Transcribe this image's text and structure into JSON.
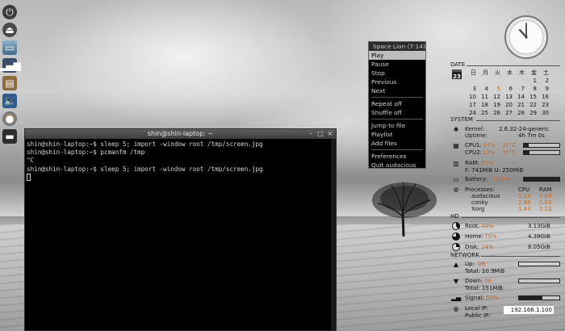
{
  "launcher": {
    "items": [
      {
        "icon": "power-icon"
      },
      {
        "icon": "eject-icon"
      },
      {
        "icon": "drive-icon"
      },
      {
        "icon": "network-signal-icon"
      },
      {
        "icon": "clipboard-icon"
      },
      {
        "icon": "volume-icon"
      },
      {
        "icon": "firefox-icon"
      },
      {
        "icon": "monitor-icon"
      }
    ]
  },
  "terminal": {
    "title": "shin@shin-laptop: ~",
    "lines": [
      "shin@shin-laptop:~$ sleep 5; import -window root /tmp/screen.jpg",
      "shin@shin-laptop:~$ pcmanfm /tmp",
      "^C",
      "shin@shin-laptop:~$ sleep 5; import -window root /tmp/screen.jpg"
    ]
  },
  "menu": {
    "title": "Space Lion (7:14)",
    "groups": [
      [
        "Play",
        "Pause",
        "Stop",
        "Previous",
        "Next"
      ],
      [
        "Repeat off",
        "Shuffle off"
      ],
      [
        "Jump to file",
        "Playlist",
        "Add files"
      ],
      [
        "Preferences",
        "Quit audacious"
      ]
    ],
    "active": "Play"
  },
  "conky": {
    "date_title": "DATE",
    "calendar": {
      "icon_day": "23",
      "weekdays": [
        "日",
        "月",
        "火",
        "水",
        "木",
        "金",
        "土"
      ],
      "rows": [
        [
          "",
          "",
          "",
          "",
          "",
          "1",
          "2"
        ],
        [
          "3",
          "4",
          "5",
          "6",
          "7",
          "8",
          "9"
        ],
        [
          "10",
          "11",
          "12",
          "13",
          "14",
          "15",
          "16"
        ],
        [
          "17",
          "18",
          "19",
          "20",
          "21",
          "22",
          "23"
        ],
        [
          "24",
          "25",
          "26",
          "27",
          "28",
          "29",
          "30"
        ]
      ],
      "highlight": "5"
    },
    "system_title": "SYSTEM",
    "kernel_label": "Kernel:",
    "kernel_value": "2.6.32-24-generic",
    "uptime_label": "Uptime:",
    "uptime_value": "4h 7m 0s",
    "cpu1_label": "CPU1:",
    "cpu1_pct": "14%",
    "cpu1_temp": "35°C",
    "cpu1_level": 0.14,
    "cpu2_label": "CPU2:",
    "cpu2_pct": "17%",
    "cpu2_temp": "35°C",
    "cpu2_level": 0.17,
    "ram_label": "RAM:",
    "ram_pct": "25%",
    "ram_detail": "F: 741MiB U: 250MiB",
    "ram_level": 0.25,
    "battery_label": "Battery:",
    "battery_value": "100%",
    "battery_level": 1.0,
    "proc_label": "Processes:",
    "proc_cpu_header": "CPU",
    "proc_ram_header": "RAM",
    "processes": [
      {
        "name": "audacious",
        "cpu": "5.29",
        "ram": "2.88"
      },
      {
        "name": "conky",
        "cpu": "2.88",
        "ram": "0.63"
      },
      {
        "name": "Xorg",
        "cpu": "1.44",
        "ram": "2.12"
      }
    ],
    "hd_title": "HD",
    "root_label": "Root:",
    "root_pct": "40%",
    "root_size": "3.13GiB",
    "home_label": "Home:",
    "home_pct": "75%",
    "home_size": "4.39GiB",
    "disk_label": "Disk:",
    "disk_pct": "24%",
    "disk_size": "8.05GiB",
    "network_title": "NETWORK",
    "up_label": "Up:",
    "up_value": "0B",
    "up_total": "Total: 10.9MiB",
    "down_label": "Down:",
    "down_value": "0B",
    "down_total": "Total: 151MiB",
    "signal_label": "Signal:",
    "signal_value": "58%",
    "signal_level": 0.58,
    "local_ip_label": "Local IP:",
    "local_ip_value": "192.168.1.100",
    "public_ip_label": "Public IP:"
  },
  "colors": {
    "accent_orange": "#c86a1e",
    "menu_highlight": "#bdbdbd",
    "terminal_bg": "#000000"
  }
}
